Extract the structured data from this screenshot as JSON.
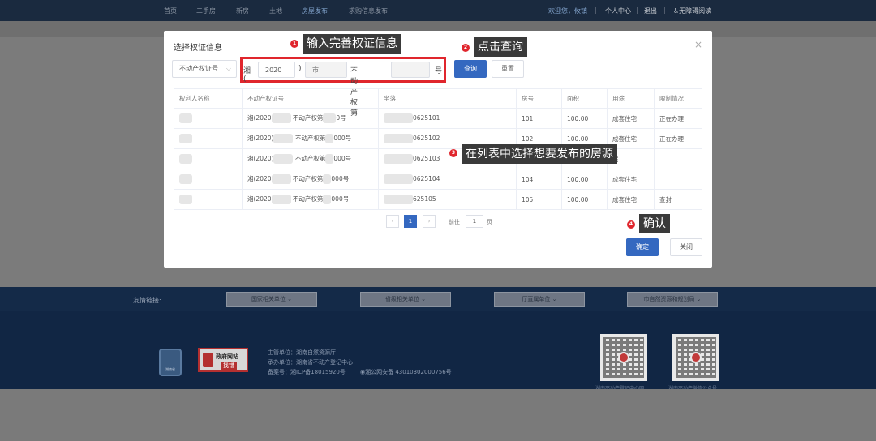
{
  "topnav": {
    "items": [
      "首页",
      "二手房",
      "新房",
      "土地",
      "房屋发布",
      "求购信息发布"
    ],
    "active_index": 4,
    "right_items": [
      "欢迎您，攸镇",
      "个人中心",
      "退出",
      "无障碍阅读"
    ]
  },
  "modal": {
    "title": "选择权证信息",
    "close_symbol": "×",
    "cert_type": "不动产权证号",
    "cert_prefix": "湘(",
    "year": "2020",
    "paren_close": ")",
    "city_placeholder": "市",
    "cert_mid": "不动产权第",
    "cert_suffix": "号",
    "query_button": "查询",
    "reset_button": "重置",
    "confirm_button": "确定",
    "close_button": "关闭"
  },
  "table": {
    "headers": [
      "权利人名称",
      "不动产权证号",
      "坐落",
      "房号",
      "面积",
      "用途",
      "限制情况"
    ],
    "rows": [
      {
        "cert_a": "湘(2020",
        "cert_b": "不动产权第",
        "cert_c": "0号",
        "addr": "0625101",
        "room": "101",
        "area": "100.00",
        "use": "成套住宅",
        "limit": "正在办理"
      },
      {
        "cert_a": "湘(2020)",
        "cert_b": "不动产权第",
        "cert_c": "000号",
        "addr": "0625102",
        "room": "102",
        "area": "100.00",
        "use": "成套住宅",
        "limit": "正在办理"
      },
      {
        "cert_a": "湘(2020)",
        "cert_b": "不动产权第",
        "cert_c": "000号",
        "addr": "0625103",
        "room": "103",
        "area": "100.00",
        "use": "宅",
        "limit": ""
      },
      {
        "cert_a": "湘(2020",
        "cert_b": "不动产权第",
        "cert_c": "000号",
        "addr": "0625104",
        "room": "104",
        "area": "100.00",
        "use": "成套住宅",
        "limit": ""
      },
      {
        "cert_a": "湘(2020",
        "cert_b": "不动产权第",
        "cert_c": "000号",
        "addr": "625105",
        "room": "105",
        "area": "100.00",
        "use": "成套住宅",
        "limit": "查封"
      }
    ]
  },
  "pagination": {
    "prev": "‹",
    "current": "1",
    "next": "›",
    "goto_label": "前往",
    "goto_value": "1",
    "page_unit": "页"
  },
  "annotations": [
    {
      "num": "1",
      "text": "输入完善权证信息"
    },
    {
      "num": "2",
      "text": "点击查询"
    },
    {
      "num": "3",
      "text": "在列表中选择想要发布的房源"
    },
    {
      "num": "4",
      "text": "确认"
    }
  ],
  "linkbar": {
    "label": "友情链接:",
    "selects": [
      "国家相关单位",
      "省级相关单位",
      "厅直属单位",
      "市自然资源和规划局"
    ]
  },
  "footer": {
    "logo1_text": "湖南省",
    "gov_logo_line1": "政府网站",
    "gov_logo_line2": "找错",
    "host": "主管单位：湖南自然资源厅",
    "organizer": "承办单位：湖南省不动产登记中心",
    "icp": "备案号：湘ICP备18015920号",
    "police": "湘公网安备 43010302000756号",
    "qr1_label": "湖南不动产登记中心网",
    "qr2_label": "湖南不动产微信公众号"
  },
  "colors": {
    "primary": "#3468c0",
    "annotation": "#e0262d",
    "nav_bg": "#1a2a3f",
    "footer_bg": "#112644"
  }
}
